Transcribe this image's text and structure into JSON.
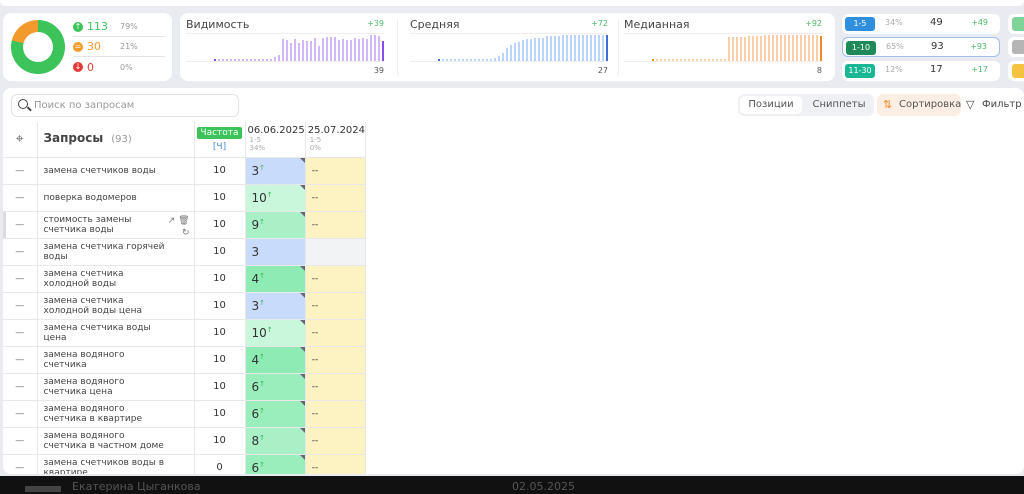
{
  "summary": {
    "up": {
      "count": "113",
      "pct": "79%"
    },
    "same": {
      "count": "30",
      "pct": "21%"
    },
    "down": {
      "count": "0",
      "pct": "0%"
    },
    "colors": {
      "up": "#3cc45a",
      "same": "#f39a2c",
      "down": "#e53935"
    }
  },
  "sparks": [
    {
      "title": "Видимость",
      "delta": "+39",
      "value": "39",
      "color": "#d3b8f7",
      "accent": "#8a4ee8",
      "values": [
        0,
        0,
        0,
        0,
        0,
        0,
        0,
        0,
        0,
        0,
        0,
        0,
        0,
        0,
        3,
        5,
        8,
        27,
        26,
        22,
        27,
        22,
        26,
        25,
        25,
        28,
        19,
        28,
        30,
        30,
        30,
        26,
        27,
        26,
        26,
        28,
        27,
        28,
        27,
        32,
        32,
        31,
        25
      ]
    },
    {
      "title": "Средняя",
      "delta": "+72",
      "value": "27",
      "color": "#bcd4f7",
      "accent": "#3a6fd8",
      "values": [
        0,
        0,
        0,
        0,
        0,
        0,
        0,
        0,
        0,
        0,
        0,
        0,
        0,
        0,
        2,
        4,
        6,
        10,
        12,
        14,
        15,
        16,
        17,
        17,
        18,
        18,
        18,
        19,
        19,
        19,
        19,
        20,
        20,
        20,
        20,
        20,
        20,
        20,
        20,
        20,
        20,
        20,
        20
      ]
    },
    {
      "title": "Медианная",
      "delta": "+92",
      "value": "8",
      "color": "#f9cfa9",
      "accent": "#f08a24",
      "values": [
        0,
        0,
        0,
        0,
        0,
        0,
        0,
        0,
        0,
        0,
        0,
        0,
        0,
        0,
        0,
        0,
        0,
        0,
        0,
        26,
        26,
        26,
        26,
        26,
        27,
        27,
        27,
        27,
        28,
        28,
        28,
        28,
        28,
        28,
        28,
        28,
        28,
        28,
        28,
        28,
        28,
        28,
        27
      ]
    }
  ],
  "buckets": [
    {
      "label": "1-5",
      "pct": "34%",
      "count": "49",
      "delta": "+49",
      "color": "#2f8fdc"
    },
    {
      "label": "1-10",
      "pct": "65%",
      "count": "93",
      "delta": "+93",
      "color": "#1e8a5a",
      "selected": true
    },
    {
      "label": "11-30",
      "pct": "12%",
      "count": "17",
      "delta": "+17",
      "color": "#19b894"
    }
  ],
  "bucket_stubs": [
    "#7fd49a",
    "#b5b5b5",
    "#f5c242"
  ],
  "toolbar": {
    "search_placeholder": "Поиск по запросам",
    "tab_positions": "Позиции",
    "tab_snippets": "Сниппеты",
    "sort": "Сортировка",
    "filter": "Фильтр"
  },
  "table": {
    "header": {
      "queries": "Запросы",
      "count": "(93)",
      "freq": "Частота",
      "freq_type": "[Ч]",
      "dates": [
        {
          "date": "06.06.2025",
          "range": "1-5",
          "pct": "34%"
        },
        {
          "date": "25.07.2024",
          "range": "1-5",
          "pct": "0%"
        }
      ]
    },
    "rows": [
      {
        "query": "замена счетчиков воды",
        "freq": "10",
        "pos": "3",
        "up": true,
        "bg": "#c9dbfa",
        "prev": "--"
      },
      {
        "query": "поверка водомеров",
        "freq": "10",
        "pos": "10",
        "up": true,
        "bg": "#c8f7dc",
        "prev": "--"
      },
      {
        "query": "стоимость замены счетчика воды",
        "freq": "10",
        "pos": "9",
        "up": true,
        "bg": "#a9f0c6",
        "prev": "--",
        "hover": true
      },
      {
        "query": "замена счетчика горячей воды",
        "freq": "10",
        "pos": "3",
        "up": false,
        "bg": "#c9dbfa",
        "prev": ""
      },
      {
        "query": "замена счетчика холодной воды",
        "freq": "10",
        "pos": "4",
        "up": true,
        "bg": "#8eebb3",
        "prev": "--"
      },
      {
        "query": "замена счетчика холодной воды цена",
        "freq": "10",
        "pos": "3",
        "up": true,
        "bg": "#c9dbfa",
        "prev": "--"
      },
      {
        "query": "замена счетчика воды цена",
        "freq": "10",
        "pos": "10",
        "up": true,
        "bg": "#c8f7dc",
        "prev": "--"
      },
      {
        "query": "замена водяного счетчика",
        "freq": "10",
        "pos": "4",
        "up": true,
        "bg": "#8eebb3",
        "prev": "--"
      },
      {
        "query": "замена водяного счетчика цена",
        "freq": "10",
        "pos": "6",
        "up": true,
        "bg": "#9aeebb",
        "prev": "--"
      },
      {
        "query": "замена водяного счетчика в квартире",
        "freq": "10",
        "pos": "6",
        "up": true,
        "bg": "#9aeebb",
        "prev": "--"
      },
      {
        "query": "замена водяного счетчика в частном доме",
        "freq": "10",
        "pos": "8",
        "up": true,
        "bg": "#a9f0c6",
        "prev": "--"
      },
      {
        "query": "замена счетчиков воды в квартире",
        "freq": "0",
        "pos": "6",
        "up": true,
        "bg": "#9aeebb",
        "prev": "--"
      }
    ]
  },
  "footer": {
    "name": "Екатерина Цыганкова",
    "date": "02.05.2025"
  }
}
